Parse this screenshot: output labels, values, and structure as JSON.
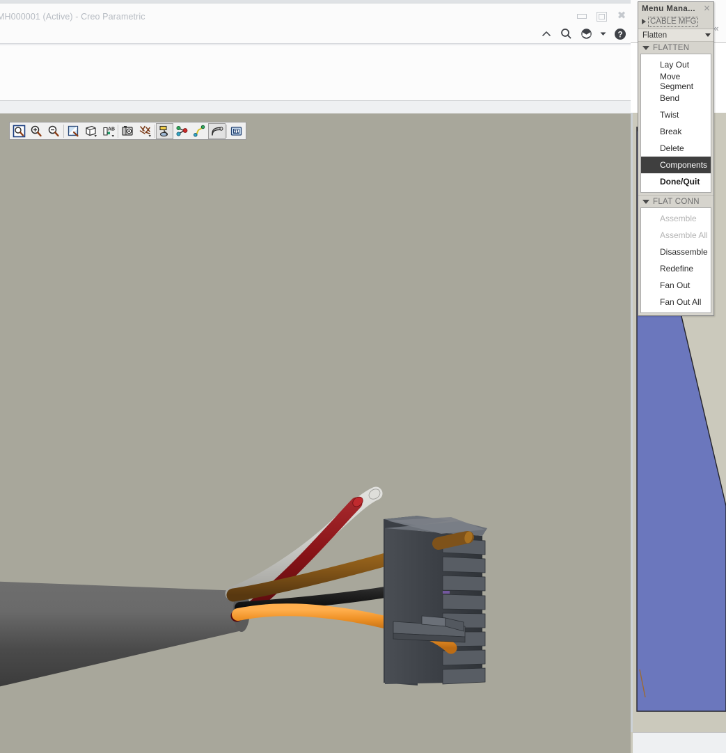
{
  "window": {
    "title": "MH000001 (Active) - Creo Parametric",
    "controls": {
      "minimize": "minimize",
      "restore": "restore",
      "close": "close"
    }
  },
  "quick_access": [
    {
      "name": "collapse-ribbon-icon",
      "label": "Minimize the Ribbon"
    },
    {
      "name": "search-icon",
      "label": "Search"
    },
    {
      "name": "learning-connector-icon",
      "label": "Learning Connector"
    },
    {
      "name": "learning-dropdown-icon",
      "label": "Open Learning Menu"
    },
    {
      "name": "help-icon",
      "label": "Help"
    }
  ],
  "graphics_toolbar": [
    {
      "name": "refit-icon",
      "label": "Refit",
      "pressed": false
    },
    {
      "name": "zoom-in-icon",
      "label": "Zoom In",
      "pressed": false
    },
    {
      "name": "zoom-out-icon",
      "label": "Zoom Out",
      "pressed": false
    },
    {
      "name": "repaint-icon",
      "label": "Repaint",
      "pressed": false
    },
    {
      "name": "display-style-icon",
      "label": "Display Style",
      "pressed": false
    },
    {
      "name": "annotation-display-icon",
      "label": "Annotation Display",
      "pressed": false
    },
    {
      "name": "saved-orientations-icon",
      "label": "Saved Orientations",
      "pressed": false
    },
    {
      "name": "datum-display-filters-icon",
      "label": "Datum Display Filters",
      "pressed": false
    },
    {
      "name": "spool-display-icon",
      "label": "Spool Display",
      "pressed": true
    },
    {
      "name": "connector-display-icon",
      "label": "Connector Display",
      "pressed": false
    },
    {
      "name": "cable-display-icon",
      "label": "Cable Display",
      "pressed": false
    },
    {
      "name": "cable-location-display-icon",
      "label": "Cable Location Display",
      "pressed": true
    },
    {
      "name": "logical-reference-display-icon",
      "label": "Logical Reference Display",
      "pressed": false
    }
  ],
  "menu_manager": {
    "title": "Menu Mana...",
    "close_label": "✕",
    "root_item": "CABLE MFG",
    "combo_value": "Flatten",
    "groups": [
      {
        "name": "flatten",
        "header": "FLATTEN",
        "items": [
          {
            "label": "Lay Out",
            "state": "normal"
          },
          {
            "label": "Move Segment",
            "state": "normal"
          },
          {
            "label": "Bend",
            "state": "normal"
          },
          {
            "label": "Twist",
            "state": "normal"
          },
          {
            "label": "Break",
            "state": "normal"
          },
          {
            "label": "Delete",
            "state": "normal"
          },
          {
            "label": "Components",
            "state": "selected"
          },
          {
            "label": "Done/Quit",
            "state": "bold"
          }
        ]
      },
      {
        "name": "flat-conn",
        "header": "FLAT CONN",
        "items": [
          {
            "label": "Assemble",
            "state": "disabled"
          },
          {
            "label": "Assemble All",
            "state": "disabled"
          },
          {
            "label": "Disassemble",
            "state": "normal"
          },
          {
            "label": "Redefine",
            "state": "normal"
          },
          {
            "label": "Fan Out",
            "state": "normal"
          },
          {
            "label": "Fan Out All",
            "state": "normal"
          }
        ]
      }
    ]
  },
  "viewport": {
    "background_color": "#a8a79b",
    "model_name": "cable-harness-connector-assembly",
    "wires": [
      {
        "name": "wire-white",
        "color": "#cdcdc9"
      },
      {
        "name": "wire-red",
        "color": "#8e1418"
      },
      {
        "name": "wire-brown",
        "color": "#8a5a19"
      },
      {
        "name": "wire-black",
        "color": "#1c1c1c"
      },
      {
        "name": "wire-orange",
        "color": "#ef9226"
      }
    ],
    "jacket_color": "#4a4a4a",
    "connector_color": "#3c4046"
  },
  "background_window": {
    "surface_color": "#6b77bd",
    "background_color": "#cbc9bc",
    "collapse_icon": "«"
  }
}
